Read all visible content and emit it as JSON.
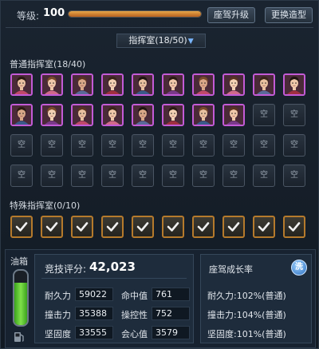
{
  "header": {
    "level_label": "等级:",
    "level_value": "100",
    "level_progress": 1.0,
    "upgrade_button": "座驾升级",
    "change_button": "更换造型"
  },
  "room_selector": {
    "label": "指挥室(18/50)",
    "arrow": "▼"
  },
  "normal_room": {
    "title": "普通指挥室(18/40)",
    "filled_count": 18,
    "empty_label": "空",
    "total_slots": 40
  },
  "special_room": {
    "title": "特殊指挥室(0/10)",
    "slot_count": 10
  },
  "fuel": {
    "label": "油箱",
    "level": 0.78
  },
  "stats": {
    "score_label": "竞技评分:",
    "score_value": "42,023",
    "items": [
      {
        "label": "耐久力",
        "value": "59022"
      },
      {
        "label": "命中值",
        "value": "761"
      },
      {
        "label": "撞击力",
        "value": "35388"
      },
      {
        "label": "操控性",
        "value": "752"
      },
      {
        "label": "坚固度",
        "value": "33555"
      },
      {
        "label": "会心值",
        "value": "3579"
      }
    ]
  },
  "growth": {
    "title": "座驾成长率",
    "wash_label": "洗",
    "lines": [
      "耐久力:102%(普通)",
      "撞击力:104%(普通)",
      "坚固度:101%(普通)"
    ]
  },
  "colors": {
    "slot_face_border": "#c35bd6",
    "slot_check_border": "#b57a2c",
    "fuel_green": "#7fe04a",
    "level_orange": "#e8a84a"
  }
}
